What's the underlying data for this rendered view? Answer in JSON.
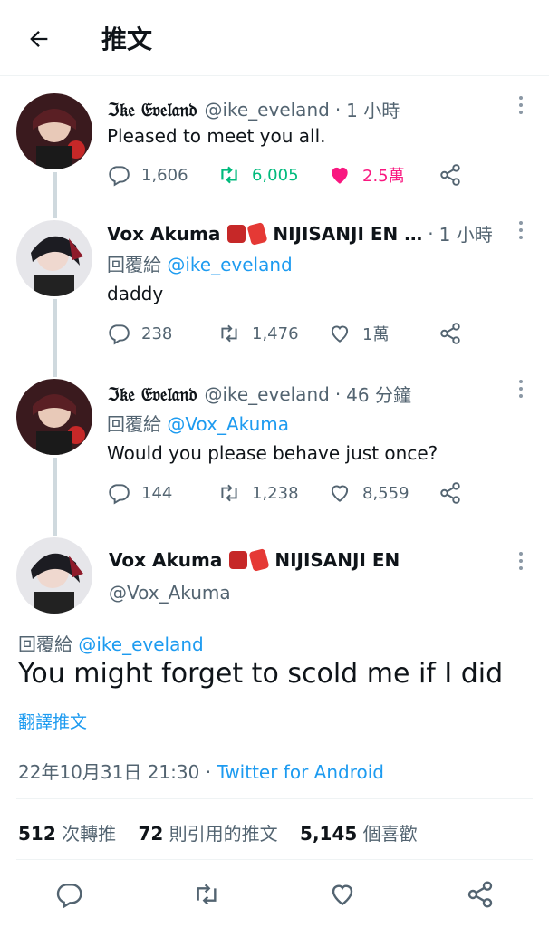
{
  "header": {
    "title": "推文"
  },
  "tweets": [
    {
      "name": "ℑ𝔨𝔢 𝔈𝔳𝔢𝔩𝔞𝔫𝔡",
      "handle": "@ike_eveland",
      "time": "1 小時",
      "reply_prefix": "",
      "reply_mention": "",
      "text": "Pleased to meet you all.",
      "replies": "1,606",
      "retweets": "6,005",
      "likes": "2.5萬",
      "liked": true,
      "retweeted": true
    },
    {
      "name": "Vox Akuma",
      "badge_text": "NIJISANJI EN …",
      "handle": "",
      "time": "1 小時",
      "reply_prefix": "回覆給",
      "reply_mention": "@ike_eveland",
      "text": "daddy",
      "replies": "238",
      "retweets": "1,476",
      "likes": "1萬",
      "liked": false,
      "retweeted": false
    },
    {
      "name": "ℑ𝔨𝔢 𝔈𝔳𝔢𝔩𝔞𝔫𝔡",
      "handle": "@ike_eveland",
      "time": "46 分鐘",
      "reply_prefix": "回覆給",
      "reply_mention": "@Vox_Akuma",
      "text": "Would you please behave just once?",
      "replies": "144",
      "retweets": "1,238",
      "likes": "8,559",
      "liked": false,
      "retweeted": false
    }
  ],
  "main_tweet": {
    "name": "Vox Akuma",
    "badge_text": "NIJISANJI EN",
    "handle": "@Vox_Akuma",
    "reply_prefix": "回覆給",
    "reply_mention": "@ike_eveland",
    "text": "You might forget to scold me if I did",
    "translate": "翻譯推文",
    "date": "22年10月31日 21:30",
    "source": "Twitter for Android",
    "retweets_count": "512",
    "retweets_label": "次轉推",
    "quotes_count": "72",
    "quotes_label": "則引用的推文",
    "likes_count": "5,145",
    "likes_label": "個喜歡"
  },
  "colors": {
    "accent": "#1d9bf0",
    "retweet": "#00ba7c",
    "like": "#f91880",
    "muted": "#536471"
  },
  "icons": [
    "back-arrow-icon",
    "reply-icon",
    "retweet-icon",
    "like-icon",
    "share-icon",
    "more-icon"
  ]
}
